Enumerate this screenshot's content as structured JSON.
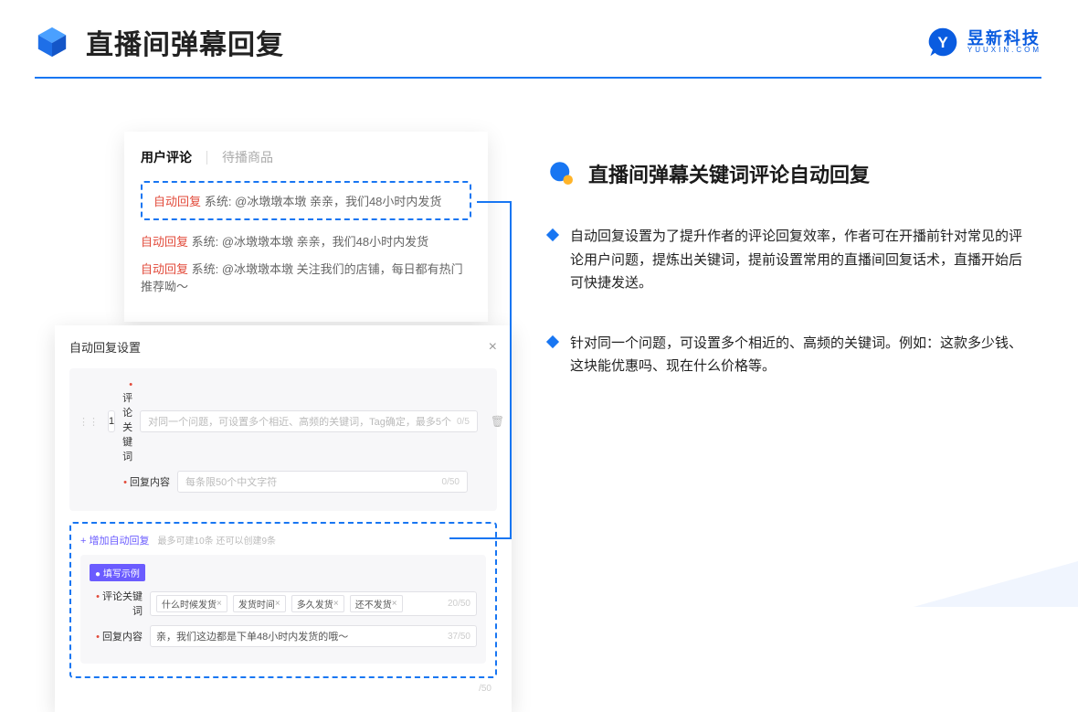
{
  "page_title": "直播间弹幕回复",
  "brand": {
    "cn": "昱新科技",
    "en": "YUUXIN.COM"
  },
  "panel_top": {
    "tab_active": "用户评论",
    "tab_inactive": "待播商品",
    "highlighted": {
      "tag": "自动回复",
      "text": "系统: @冰墩墩本墩 亲亲，我们48小时内发货"
    },
    "line2": {
      "tag": "自动回复",
      "text": "系统: @冰墩墩本墩 亲亲，我们48小时内发货"
    },
    "line3": {
      "tag": "自动回复",
      "text": "系统: @冰墩墩本墩 关注我们的店铺，每日都有热门推荐呦～"
    }
  },
  "panel_bottom": {
    "title": "自动回复设置",
    "index": "1",
    "kw_label": "评论关键词",
    "kw_placeholder": "对同一个问题，可设置多个相近、高频的关键词，Tag确定，最多5个",
    "kw_counter": "0/5",
    "content_label": "回复内容",
    "content_placeholder": "每条限50个中文字符",
    "content_counter": "0/50",
    "add_link": "+ 增加自动回复",
    "add_hint": "最多可建10条 还可以创建9条",
    "example_badge": "● 填写示例",
    "ex_kw_label": "评论关键词",
    "ex_tags": [
      "什么时候发货",
      "发货时间",
      "多久发货",
      "还不发货"
    ],
    "ex_kw_counter": "20/50",
    "ex_content_label": "回复内容",
    "ex_content_value": "亲，我们这边都是下单48小时内发货的哦～",
    "ex_content_counter": "37/50",
    "outside_counter": "/50"
  },
  "section": {
    "heading": "直播间弹幕关键词评论自动回复",
    "bullets": [
      "自动回复设置为了提升作者的评论回复效率，作者可在开播前针对常见的评论用户问题，提炼出关键词，提前设置常用的直播间回复话术，直播开始后可快捷发送。",
      "针对同一个问题，可设置多个相近的、高频的关键词。例如：这款多少钱、这块能优惠吗、现在什么价格等。"
    ]
  }
}
